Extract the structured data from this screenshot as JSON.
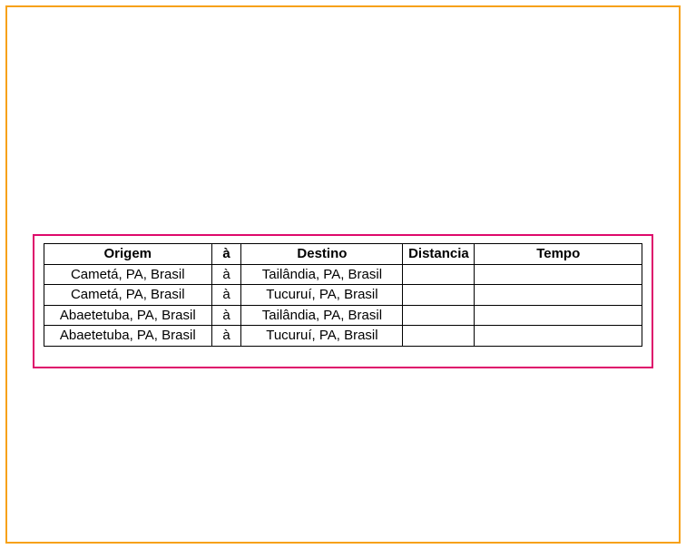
{
  "table": {
    "headers": {
      "origem": "Origem",
      "a": "à",
      "destino": "Destino",
      "distancia": "Distancia",
      "tempo": "Tempo"
    },
    "rows": [
      {
        "origem": "Cametá, PA, Brasil",
        "a": "à",
        "destino": "Tailândia, PA, Brasil",
        "distancia": "",
        "tempo": ""
      },
      {
        "origem": "Cametá, PA, Brasil",
        "a": "à",
        "destino": "Tucuruí, PA, Brasil",
        "distancia": "",
        "tempo": ""
      },
      {
        "origem": "Abaetetuba, PA, Brasil",
        "a": "à",
        "destino": "Tailândia, PA, Brasil",
        "distancia": "",
        "tempo": ""
      },
      {
        "origem": "Abaetetuba, PA, Brasil",
        "a": "à",
        "destino": "Tucuruí, PA, Brasil",
        "distancia": "",
        "tempo": ""
      }
    ]
  }
}
